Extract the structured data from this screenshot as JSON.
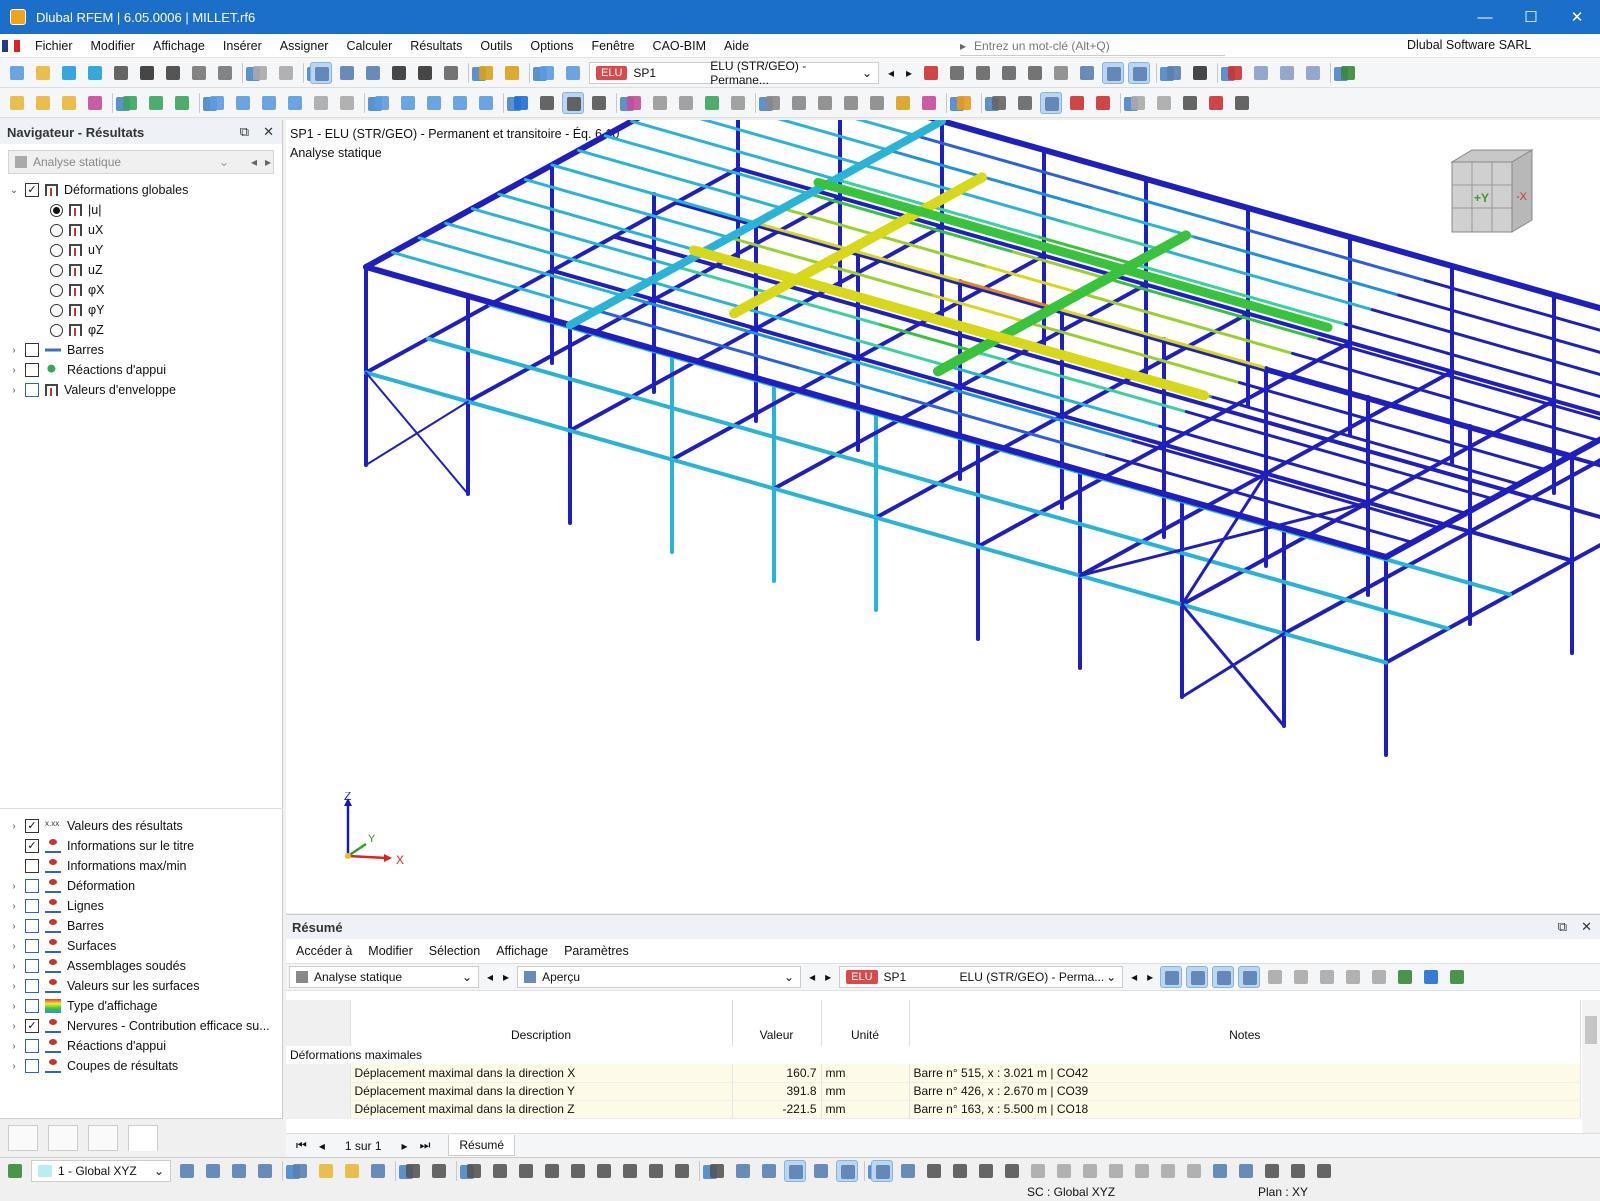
{
  "window": {
    "title": "Dlubal RFEM | 6.05.0006 | MILLET.rf6",
    "minimize": "—",
    "maximize": "☐",
    "close": "✕"
  },
  "menu": {
    "items": [
      "Fichier",
      "Modifier",
      "Affichage",
      "Insérer",
      "Assigner",
      "Calculer",
      "Résultats",
      "Outils",
      "Options",
      "Fenêtre",
      "CAO-BIM",
      "Aide"
    ],
    "search_placeholder": "Entrez un mot-clé (Alt+Q)",
    "company": "Dlubal Software SARL"
  },
  "toolbar1": {
    "elu_badge": "ELU",
    "lc": "SP1",
    "combo": "ELU (STR/GEO) - Permane..."
  },
  "navigator": {
    "title": "Navigateur - Résultats",
    "analysis": "Analyse statique",
    "tree": [
      {
        "label": "Déformations globales",
        "checked": true
      },
      {
        "label": "|u|",
        "selected": true
      },
      {
        "label": "uX"
      },
      {
        "label": "uY"
      },
      {
        "label": "uZ"
      },
      {
        "label": "φX"
      },
      {
        "label": "φY"
      },
      {
        "label": "φZ"
      },
      {
        "label": "Barres"
      },
      {
        "label": "Réactions d'appui"
      },
      {
        "label": "Valeurs d'enveloppe"
      }
    ],
    "display": [
      {
        "label": "Valeurs des résultats",
        "checked": true
      },
      {
        "label": "Informations sur le titre",
        "checked": true
      },
      {
        "label": "Informations max/min",
        "checked": false
      },
      {
        "label": "Déformation"
      },
      {
        "label": "Lignes"
      },
      {
        "label": "Barres"
      },
      {
        "label": "Surfaces"
      },
      {
        "label": "Assemblages soudés"
      },
      {
        "label": "Valeurs sur les surfaces"
      },
      {
        "label": "Type d'affichage"
      },
      {
        "label": "Nervures - Contribution efficace su...",
        "checked": true
      },
      {
        "label": "Réactions d'appui"
      },
      {
        "label": "Coupes de résultats"
      }
    ]
  },
  "viewport": {
    "title_line1": "SP1 - ELU (STR/GEO) - Permanent et transitoire - Éq. 6.10",
    "title_line2": "Analyse statique",
    "cube_y": "+Y",
    "cube_x": "-X",
    "axis_z": "Z",
    "axis_y": "Y",
    "axis_x": "X"
  },
  "summary": {
    "title": "Résumé",
    "menu": [
      "Accéder à",
      "Modifier",
      "Sélection",
      "Affichage",
      "Paramètres"
    ],
    "analysis": "Analyse statique",
    "view": "Aperçu",
    "elu": "ELU",
    "lc": "SP1",
    "combo": "ELU (STR/GEO) - Perma...",
    "columns": [
      "Description",
      "Valeur",
      "Unité",
      "Notes"
    ],
    "group": "Déformations maximales",
    "rows": [
      {
        "desc": "Déplacement maximal dans la direction X",
        "value": "160.7",
        "unit": "mm",
        "notes": "Barre n° 515, x : 3.021 m | CO42"
      },
      {
        "desc": "Déplacement maximal dans la direction Y",
        "value": "391.8",
        "unit": "mm",
        "notes": "Barre n° 426, x : 2.670 m | CO39"
      },
      {
        "desc": "Déplacement maximal dans la direction Z",
        "value": "-221.5",
        "unit": "mm",
        "notes": "Barre n° 163, x : 5.500 m | CO18"
      }
    ],
    "pager": "1 sur 1",
    "tab": "Résumé"
  },
  "status": {
    "coord_combo": "1 - Global XYZ",
    "sc": "SC : Global XYZ",
    "plan": "Plan : XY"
  },
  "colors": {
    "title_bar": "#1b6fc9",
    "deep_blue": "#1f1fbf",
    "cyan": "#29b3d6",
    "green": "#39c23c",
    "yellow": "#d8d81a",
    "orange": "#e08a1a"
  }
}
